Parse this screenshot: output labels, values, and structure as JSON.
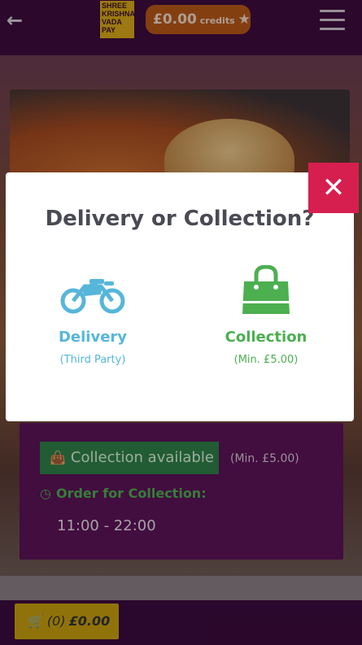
{
  "header": {
    "logo_lines": [
      "SHREE",
      "KRISHNA",
      "VADA",
      "PAY"
    ],
    "credits_amount": "£0.00",
    "credits_label": "credits"
  },
  "info": {
    "collection_badge": "Collection available",
    "collection_min": "(Min. £5.00)",
    "order_label": "Order for Collection:",
    "hours": "11:00 - 22:00"
  },
  "basket": {
    "count": "(0)",
    "total": "£0.00"
  },
  "modal": {
    "title": "Delivery or Collection?",
    "delivery": {
      "label": "Delivery",
      "sub": "(Third Party)"
    },
    "collection": {
      "label": "Collection",
      "sub": "(Min. £5.00)"
    }
  },
  "colors": {
    "header_bg": "#3e0c3d",
    "credits_bg": "#b85818",
    "close_bg": "#d61f4f",
    "delivery": "#56b6d9",
    "collection": "#4caf50",
    "basket_bg": "#c6a00e"
  },
  "icons": [
    "back-arrow-icon",
    "star-icon",
    "hamburger-icon",
    "close-icon",
    "motorbike-icon",
    "shopping-bag-icon",
    "clock-icon",
    "basket-icon"
  ]
}
